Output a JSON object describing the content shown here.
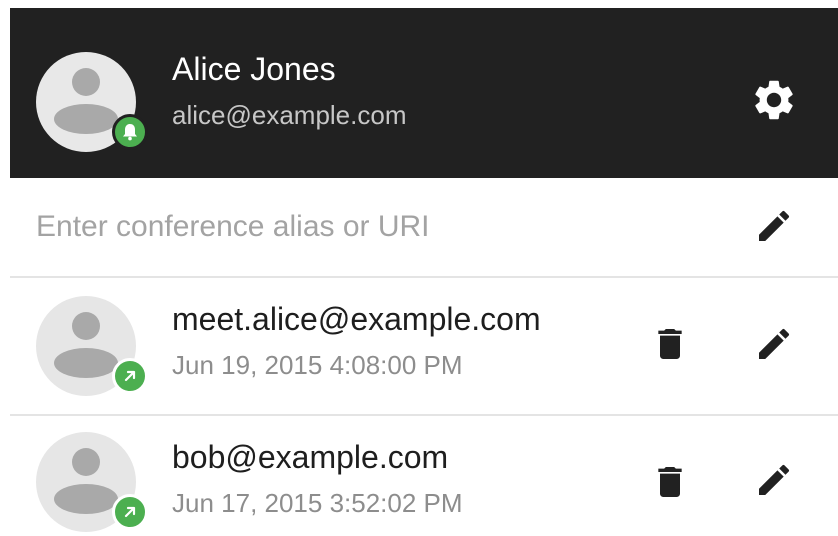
{
  "header": {
    "user_name": "Alice Jones",
    "user_email": "alice@example.com",
    "avatar_icon": "person-icon",
    "status_icon": "bell-icon",
    "status_color": "#4caf50",
    "settings_icon": "gear-icon",
    "background_color": "#212121"
  },
  "alias_field": {
    "value": "",
    "placeholder": "Enter conference alias or URI",
    "edit_icon": "pencil-icon"
  },
  "history": [
    {
      "alias": "meet.alice@example.com",
      "timestamp": "Jun 19, 2015 4:08:00 PM",
      "direction_icon": "outgoing-call-icon",
      "delete_icon": "trash-icon",
      "edit_icon": "pencil-icon"
    },
    {
      "alias": "bob@example.com",
      "timestamp": "Jun 17, 2015 3:52:02 PM",
      "direction_icon": "outgoing-call-icon",
      "delete_icon": "trash-icon",
      "edit_icon": "pencil-icon"
    }
  ]
}
